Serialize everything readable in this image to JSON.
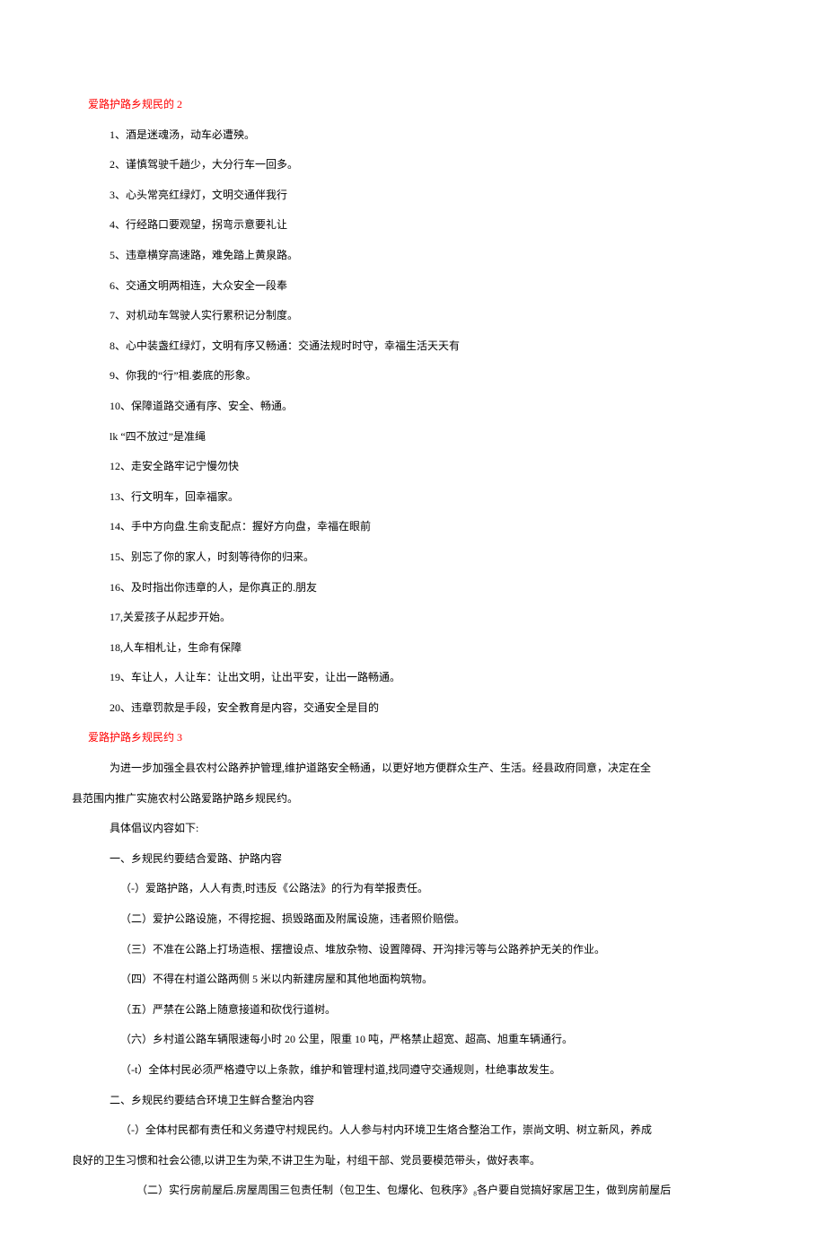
{
  "section2": {
    "title": "爱路护路乡规民的 2",
    "items": [
      "1、酒是迷魂汤，动车必遭殃。",
      "2、谨慎驾驶千趟少，大分行车一回多。",
      "3、心头常亮红绿灯，文明交通伴我行",
      "4、行经路口要观望，拐弯示意要礼让",
      "5、违章横穿高速路，难免踏上黄泉路。",
      "6、交通文明两相连，大众安全一段奉",
      "7、对机动车驾驶人实行累积记分制度。",
      "8、心中装盏红绿灯，文明有序又畅通：交通法规时时守，幸福生活天天有",
      "9、你我的“行”相.娄底的形象。",
      "10、保障道路交通有序、安全、畅通。",
      "lk “四不放过”是准绳",
      "12、走安全路牢记宁慢勿快",
      "13、行文明车，回幸福家。",
      "14、手中方向盘.生俞支配点：握好方向盘，幸福在眼前",
      "15、别忘了你的家人，时刻等待你的归来。",
      "16、及时指出你违章的人，是你真正的.朋友",
      "17,关爱孩子从起步开始。",
      "18,人车相札让，生命有保障",
      "19、车让人，人让车：让出文明，让出平安，让出一路畅通。",
      "20、违章罚款是手段，安全教育是内容，交通安全是目的"
    ]
  },
  "section3": {
    "title": "爱路护路乡规民约 3",
    "intro_line1": "为进一步加强全县农村公路养护管理,维护道路安全畅通，以更好地方便群众生产、生活。经县政府同意，决定在全",
    "intro_line2": "县范围内推广实施农村公路爱路护路乡规民约。",
    "intro_p2": "具体倡议内容如下:",
    "heading1": "一、乡规民约要结合爱路、护路内容",
    "group1": [
      "（-）爱路护路，人人有责,时违反《公路法》的行为有举报责任。",
      "（二）爱护公路设施，不得挖掘、损毁路面及附属设施，违者照价赔偿。",
      "（三）不准在公路上打场造根、摆擅设点、堆放杂物、设置障碍、开沟排污等与公路养护无关的作业。",
      "（四）不得在村道公路两侧 5 米以内新建房屋和其他地面构筑物。",
      "（五）严禁在公路上随意接道和砍伐行道树。",
      "（六）乡村道公路车辆限速每小时 20 公里，限重 10 吨，严格禁止超宽、超高、旭重车辆通行。",
      "（-t）全体村民必须严格遵守以上条款，维护和管理村道,找同遵守交通规则，杜绝事故发生。"
    ],
    "heading2": "二、乡规民约要结合环境卫生鲜合整治内容",
    "group2_p1_line1": "（-）全体村民都有责任和义务遵守村规民约。人人参与村内环境卫生烙合整治工作，崇尚文明、树立新风，养成",
    "group2_p1_line2": "良好的卫生习惯和社会公德,以讲卫生为荣,不讲卫生为耻，村组干部、党员要模范带头，做好表率。",
    "group2_p2": "（二）实行房前屋后.房屋周围三包责任制（包卫生、包爆化、包秩序》₈各户要自觉搞好家居卫生，做到房前屋后"
  }
}
